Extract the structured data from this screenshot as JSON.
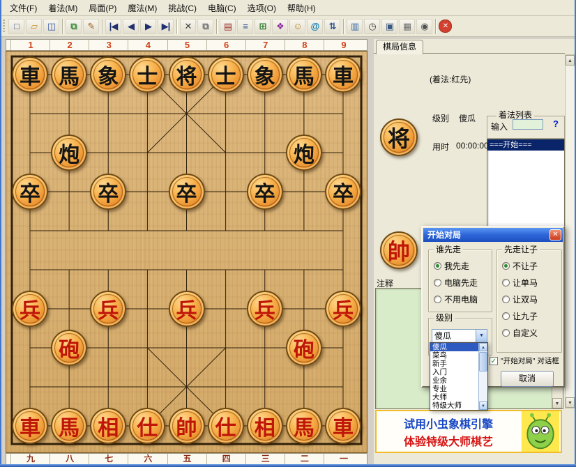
{
  "menu": {
    "items": [
      "文件(F)",
      "着法(M)",
      "局面(P)",
      "魔法(M)",
      "挑战(C)",
      "电脑(C)",
      "选项(O)",
      "帮助(H)"
    ]
  },
  "toolbar": {
    "buttons": [
      {
        "name": "new-icon",
        "glyph": "□",
        "color": "#4a5a8a"
      },
      {
        "name": "open-icon",
        "glyph": "▱",
        "color": "#c89020"
      },
      {
        "name": "save-icon",
        "glyph": "◫",
        "color": "#3a5aa8",
        "sep": true
      },
      {
        "name": "copy-position-icon",
        "glyph": "⧉",
        "color": "#3a8a3a"
      },
      {
        "name": "edit-position-icon",
        "glyph": "✎",
        "color": "#a06020",
        "sep": true
      },
      {
        "name": "first-move-icon",
        "glyph": "|◀",
        "color": "#203070"
      },
      {
        "name": "prev-move-icon",
        "glyph": "◀",
        "color": "#203070"
      },
      {
        "name": "next-move-icon",
        "glyph": "▶",
        "color": "#203070"
      },
      {
        "name": "last-move-icon",
        "glyph": "▶|",
        "color": "#203070",
        "sep": true
      },
      {
        "name": "delete-move-icon",
        "glyph": "✕",
        "color": "#404040"
      },
      {
        "name": "copy-icon",
        "glyph": "⧉",
        "color": "#707070",
        "sep": true
      },
      {
        "name": "open-book-icon",
        "glyph": "▤",
        "color": "#a03028"
      },
      {
        "name": "move-tree-icon",
        "glyph": "≡",
        "color": "#2a4a8a"
      },
      {
        "name": "score-table-icon",
        "glyph": "⊞",
        "color": "#2a7a2a"
      },
      {
        "name": "color-scheme-icon",
        "glyph": "❖",
        "color": "#8a2aa0"
      },
      {
        "name": "analysis-icon",
        "glyph": "☺",
        "color": "#c08020"
      },
      {
        "name": "online-icon",
        "glyph": "@",
        "color": "#0878b0"
      },
      {
        "name": "flip-board-icon",
        "glyph": "⇅",
        "color": "#30508a",
        "sep": true
      },
      {
        "name": "notebook-icon",
        "glyph": "▥",
        "color": "#3a6aa0"
      },
      {
        "name": "clock-icon",
        "glyph": "◷",
        "color": "#404040"
      },
      {
        "name": "computer-icon",
        "glyph": "▣",
        "color": "#3a5a80"
      },
      {
        "name": "print-icon",
        "glyph": "▦",
        "color": "#707070"
      },
      {
        "name": "camera-icon",
        "glyph": "◉",
        "color": "#505050",
        "sep": true
      },
      {
        "name": "close-app-icon",
        "glyph": "✕",
        "color": "#ffffff",
        "bg": "#d24030"
      }
    ]
  },
  "board": {
    "top_numbers": [
      "1",
      "2",
      "3",
      "4",
      "5",
      "6",
      "7",
      "8",
      "9"
    ],
    "bottom_numbers": [
      "九",
      "八",
      "七",
      "六",
      "五",
      "四",
      "三",
      "二",
      "一"
    ],
    "pieces": [
      {
        "c": "車",
        "s": "b",
        "col": 1,
        "row": 0
      },
      {
        "c": "馬",
        "s": "b",
        "col": 2,
        "row": 0
      },
      {
        "c": "象",
        "s": "b",
        "col": 3,
        "row": 0
      },
      {
        "c": "士",
        "s": "b",
        "col": 4,
        "row": 0
      },
      {
        "c": "将",
        "s": "b",
        "col": 5,
        "row": 0
      },
      {
        "c": "士",
        "s": "b",
        "col": 6,
        "row": 0
      },
      {
        "c": "象",
        "s": "b",
        "col": 7,
        "row": 0
      },
      {
        "c": "馬",
        "s": "b",
        "col": 8,
        "row": 0
      },
      {
        "c": "車",
        "s": "b",
        "col": 9,
        "row": 0
      },
      {
        "c": "炮",
        "s": "b",
        "col": 2,
        "row": 2
      },
      {
        "c": "炮",
        "s": "b",
        "col": 8,
        "row": 2
      },
      {
        "c": "卒",
        "s": "b",
        "col": 1,
        "row": 3
      },
      {
        "c": "卒",
        "s": "b",
        "col": 3,
        "row": 3
      },
      {
        "c": "卒",
        "s": "b",
        "col": 5,
        "row": 3
      },
      {
        "c": "卒",
        "s": "b",
        "col": 7,
        "row": 3
      },
      {
        "c": "卒",
        "s": "b",
        "col": 9,
        "row": 3
      },
      {
        "c": "兵",
        "s": "r",
        "col": 1,
        "row": 6
      },
      {
        "c": "兵",
        "s": "r",
        "col": 3,
        "row": 6
      },
      {
        "c": "兵",
        "s": "r",
        "col": 5,
        "row": 6
      },
      {
        "c": "兵",
        "s": "r",
        "col": 7,
        "row": 6
      },
      {
        "c": "兵",
        "s": "r",
        "col": 9,
        "row": 6
      },
      {
        "c": "砲",
        "s": "r",
        "col": 2,
        "row": 7
      },
      {
        "c": "砲",
        "s": "r",
        "col": 8,
        "row": 7
      },
      {
        "c": "車",
        "s": "r",
        "col": 1,
        "row": 9
      },
      {
        "c": "馬",
        "s": "r",
        "col": 2,
        "row": 9
      },
      {
        "c": "相",
        "s": "r",
        "col": 3,
        "row": 9
      },
      {
        "c": "仕",
        "s": "r",
        "col": 4,
        "row": 9
      },
      {
        "c": "帥",
        "s": "r",
        "col": 5,
        "row": 9
      },
      {
        "c": "仕",
        "s": "r",
        "col": 6,
        "row": 9
      },
      {
        "c": "相",
        "s": "r",
        "col": 7,
        "row": 9
      },
      {
        "c": "馬",
        "s": "r",
        "col": 8,
        "row": 9
      },
      {
        "c": "車",
        "s": "r",
        "col": 9,
        "row": 9
      }
    ]
  },
  "panel": {
    "tab": "棋局信息",
    "first_move_note": "(着法:红先)",
    "black_side_piece": "将",
    "red_side_piece": "帥",
    "level_label": "级别",
    "level_value": "傻瓜",
    "time_label": "用时",
    "time_value": "00:00:00",
    "movelist": {
      "title": "着法列表",
      "input_label": "输入",
      "input_value": "",
      "help": "?",
      "items": [
        "===开始==="
      ],
      "selected_index": 0
    },
    "comment_label": "注释"
  },
  "dialog": {
    "title": "开始对局",
    "who_first": {
      "label": "谁先走",
      "options": [
        "我先走",
        "电脑先走",
        "不用电脑"
      ],
      "selected": 0
    },
    "handicap": {
      "label": "先走让子",
      "options": [
        "不让子",
        "让单马",
        "让双马",
        "让九子",
        "自定义"
      ],
      "selected": 0
    },
    "level": {
      "label": "级别",
      "value": "傻瓜",
      "options": [
        "傻瓜",
        "菜鸟",
        "新手",
        "入门",
        "业余",
        "专业",
        "大师",
        "特级大师"
      ],
      "selected": 0
    },
    "show_dialog_checkbox": {
      "checked": true,
      "text": "\"开始对局\" 对话框"
    },
    "cancel_label": "取消"
  },
  "ad": {
    "line1": "试用小虫象棋引擎",
    "line2": "体验特级大师棋艺"
  },
  "icons": {
    "up": "▲",
    "down": "▼",
    "close": "✕",
    "check": "✓",
    "combo": "▼"
  },
  "colors": {
    "board_wood": "#d8b277",
    "piece_red": "#bf1608",
    "piece_black": "#141414",
    "selection": "#0a246a",
    "title_blue": "#1c4fc0"
  }
}
